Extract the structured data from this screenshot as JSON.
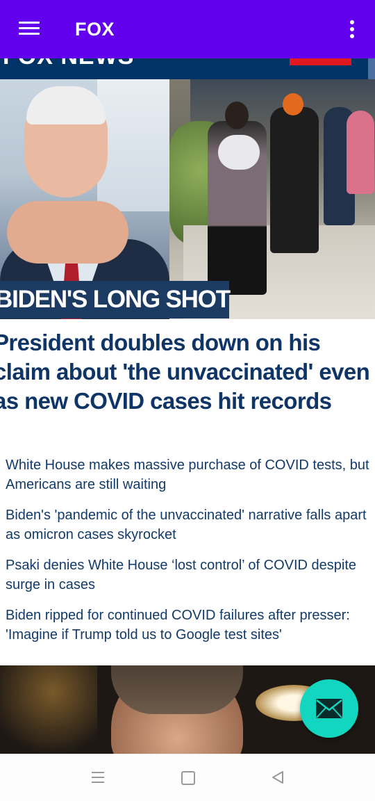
{
  "appbar": {
    "title": "FOX",
    "menu_icon": "hamburger-menu-icon",
    "overflow_icon": "more-vert-icon",
    "color": "#6200ee"
  },
  "site_header": {
    "logo_text": "FOX NEWS",
    "color": "#003366"
  },
  "lead_story": {
    "kicker": "BIDEN'S LONG SHOT",
    "headline": "President doubles down on his claim about 'the unvaccinated' even as new COVID cases hit records",
    "related": [
      "White House makes massive purchase of COVID tests, but Americans are still waiting",
      "Biden's 'pandemic of the unvaccinated' narrative falls apart as omicron cases skyrocket",
      "Psaki denies White House ‘lost control’ of COVID despite surge in cases",
      "Biden ripped for continued COVID failures after presser: 'Imagine if Trump told us to Google test sites'"
    ],
    "headline_color": "#0f3567"
  },
  "fab": {
    "icon": "mail-icon",
    "color": "#12d6c0"
  },
  "navbar": {
    "recents_icon": "recent-apps-icon",
    "home_icon": "home-square-icon",
    "back_icon": "back-triangle-icon"
  }
}
